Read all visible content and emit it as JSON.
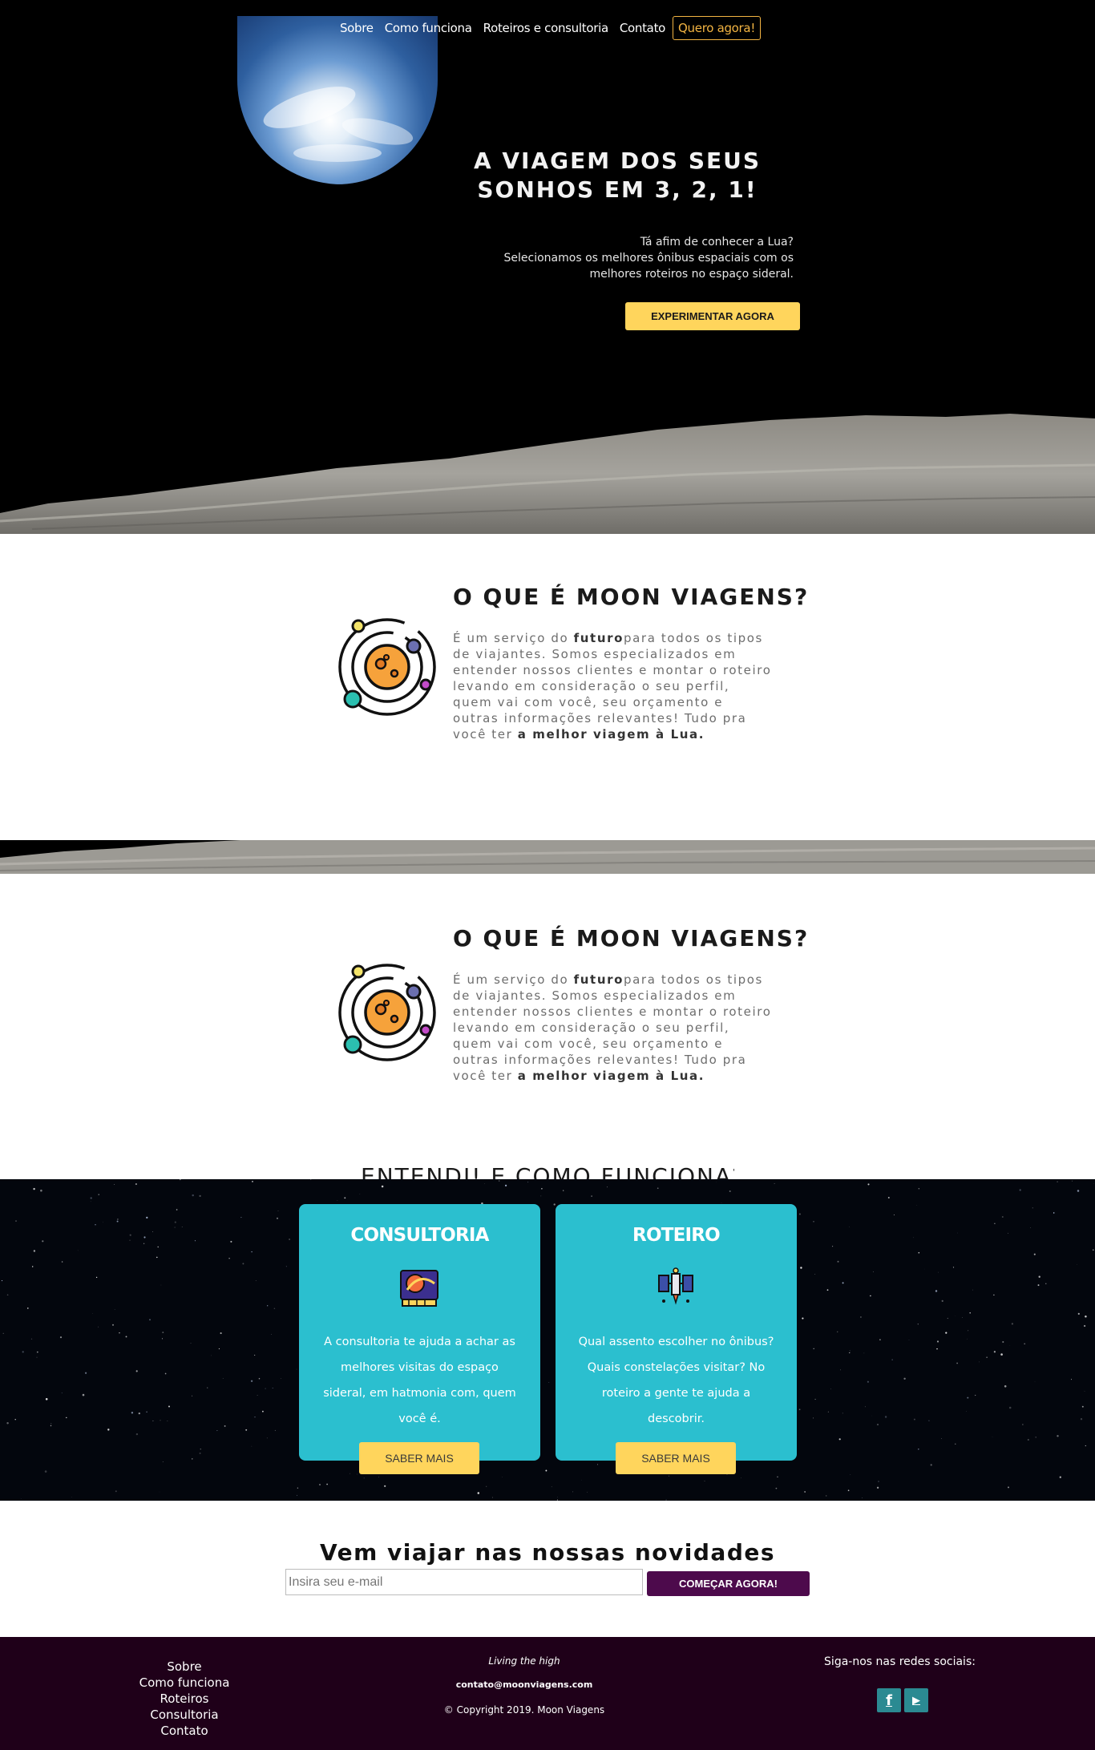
{
  "nav": {
    "items": [
      "Sobre",
      "Como funciona",
      "Roteiros e consultoria",
      "Contato"
    ],
    "cta": "Quero agora!"
  },
  "hero": {
    "title_line1": "A VIAGEM DOS SEUS",
    "title_line2": "SONHOS EM 3, 2, 1!",
    "text_line1": "Tá afim de conhecer a Lua?",
    "text_line2": "Selecionamos os melhores ônibus espaciais com os",
    "text_line3": "melhores roteiros no espaço sideral.",
    "button": "Experimentar agora"
  },
  "about": {
    "title": "O QUE É MOON VIAGENS?",
    "text_part1": "É um serviço do ",
    "text_bold1": "futuro",
    "text_part2": "para todos os tipos de viajantes. Somos especializados em entender nossos clientes e montar o roteiro levando em consideração o seu perfil, quem vai com você, seu orçamento e outras informações relevantes! Tudo pra você ter ",
    "text_bold2": "a melhor viagem à Lua.",
    "next_heading": "ENTENDI! E COMO FUNCIONA?"
  },
  "services": {
    "cards": [
      {
        "title": "CONSULTORIA",
        "icon": "satellite-map-icon",
        "text": "A consultoria te ajuda a achar as melhores visitas do espaço sideral, em hatmonia com, quem você é.",
        "button": "Saber mais"
      },
      {
        "title": "ROTEIRO",
        "icon": "space-station-icon",
        "text": "Qual assento escolher no ônibus? Quais constelações visitar? No roteiro a gente te ajuda a descobrir.",
        "button": "Saber mais"
      }
    ]
  },
  "newsletter": {
    "title": "Vem viajar nas nossas novidades",
    "placeholder": "Insira seu e-mail",
    "button": "Começar agora!"
  },
  "footer": {
    "links": [
      "Sobre",
      "Como funciona",
      "Roteiros",
      "Consultoria",
      "Contato"
    ],
    "tagline": "Living the high",
    "email": "contato@moonviagens.com",
    "copyright": "© Copyright 2019. Moon Viagens",
    "social_title": "Siga-nos nas redes sociais:",
    "social": [
      {
        "name": "facebook-icon",
        "glyph": "f"
      },
      {
        "name": "youtube-icon",
        "glyph": "▶"
      }
    ]
  },
  "colors": {
    "accent_yellow": "#ffd55c",
    "card_teal": "#2bbfcf",
    "newsletter_button": "#4d0a4c",
    "footer_bg": "#1f0019",
    "social_bg": "#2b8a92",
    "nav_cta": "#f3b442"
  }
}
